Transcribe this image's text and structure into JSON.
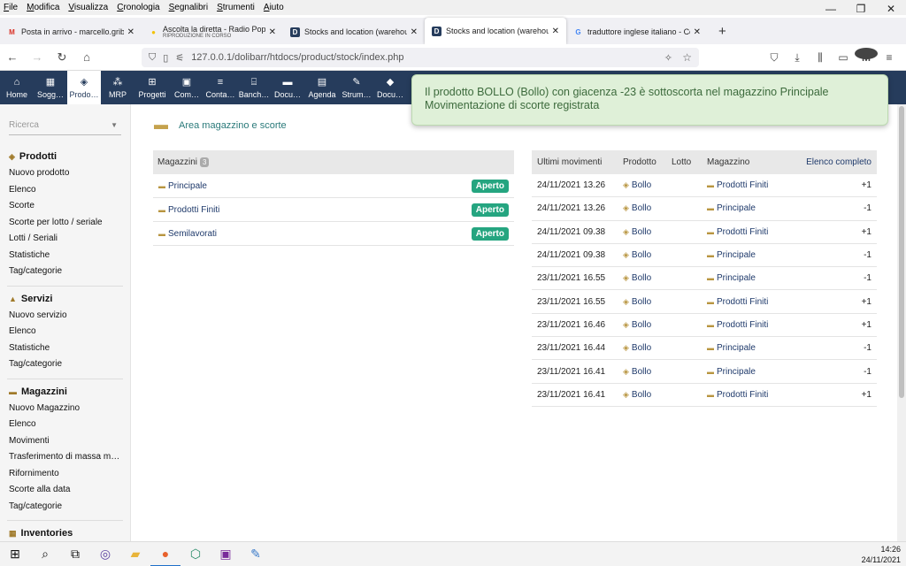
{
  "menubar": {
    "items": [
      {
        "u": "F",
        "rest": "ile"
      },
      {
        "u": "M",
        "rest": "odifica"
      },
      {
        "u": "V",
        "rest": "isualizza"
      },
      {
        "u": "C",
        "rest": "ronologia"
      },
      {
        "u": "S",
        "rest": "egnalibri"
      },
      {
        "u": "S",
        "rest": "trumenti"
      },
      {
        "u": "A",
        "rest": "iuto"
      }
    ]
  },
  "tabs": [
    {
      "title": "Posta in arrivo - marcello.gribau",
      "sub": "",
      "icon": "gmail-icon",
      "color": "#d93025"
    },
    {
      "title": "Ascolta la diretta - Radio Popola",
      "sub": "RIPRODUZIONE IN CORSO",
      "icon": "radio-icon",
      "color": "#f2c200"
    },
    {
      "title": "Stocks and location (warehouse",
      "sub": "",
      "icon": "dolibarr-icon",
      "color": "#263c5c"
    },
    {
      "title": "Stocks and location (warehouse",
      "sub": "",
      "icon": "dolibarr-icon",
      "color": "#263c5c"
    },
    {
      "title": "traduttore inglese italiano - Cerc",
      "sub": "",
      "icon": "google-icon",
      "color": "#4285f4"
    }
  ],
  "url": "127.0.0.1/dolibarr/htdocs/product/stock/index.php",
  "topmenu": [
    {
      "label": "Home",
      "icon": "home-icon",
      "glyph": "⌂"
    },
    {
      "label": "Sogg…",
      "icon": "building-icon",
      "glyph": "▦"
    },
    {
      "label": "Prodo…",
      "icon": "cube-icon",
      "glyph": "◈"
    },
    {
      "label": "MRP",
      "icon": "cubes-icon",
      "glyph": "⁂"
    },
    {
      "label": "Progetti",
      "icon": "sitemap-icon",
      "glyph": "⊞"
    },
    {
      "label": "Com…",
      "icon": "suitcase-icon",
      "glyph": "▣"
    },
    {
      "label": "Conta…",
      "icon": "coins-icon",
      "glyph": "≡"
    },
    {
      "label": "Banch…",
      "icon": "bank-icon",
      "glyph": "⌸"
    },
    {
      "label": "Docu…",
      "icon": "folder-icon",
      "glyph": "▬"
    },
    {
      "label": "Agenda",
      "icon": "calendar-icon",
      "glyph": "▤"
    },
    {
      "label": "Strum…",
      "icon": "wrench-icon",
      "glyph": "✎"
    },
    {
      "label": "Docu…",
      "icon": "book-icon",
      "glyph": "◆"
    }
  ],
  "sidebar": {
    "search_placeholder": "Ricerca",
    "sections": [
      {
        "title": "Prodotti",
        "glyph": "◈",
        "items": [
          "Nuovo prodotto",
          "Elenco",
          "Scorte",
          "Scorte per lotto / seriale",
          "Lotti / Seriali",
          "Statistiche",
          "Tag/categorie"
        ]
      },
      {
        "title": "Servizi",
        "glyph": "▲",
        "items": [
          "Nuovo servizio",
          "Elenco",
          "Statistiche",
          "Tag/categorie"
        ]
      },
      {
        "title": "Magazzini",
        "glyph": "▬",
        "items": [
          "Nuovo Magazzino",
          "Elenco",
          "Movimenti",
          "Trasferimento di massa m…",
          "Rifornimento",
          "Scorte alla data",
          "Tag/categorie"
        ]
      },
      {
        "title": "Inventories",
        "glyph": "▦",
        "items": []
      }
    ]
  },
  "page": {
    "title": "Area magazzino e scorte"
  },
  "warehouses": {
    "header": "Magazzini",
    "count": "3",
    "rows": [
      {
        "name": "Principale",
        "status": "Aperto"
      },
      {
        "name": "Prodotti Finiti",
        "status": "Aperto"
      },
      {
        "name": "Semilavorati",
        "status": "Aperto"
      }
    ]
  },
  "movements": {
    "headers": {
      "date": "Ultimi movimenti",
      "product": "Prodotto",
      "lot": "Lotto",
      "warehouse": "Magazzino",
      "full_list": "Elenco completo"
    },
    "rows": [
      {
        "date": "24/11/2021 13.26",
        "product": "Bollo",
        "lot": "",
        "warehouse": "Prodotti Finiti",
        "qty": "+1"
      },
      {
        "date": "24/11/2021 13.26",
        "product": "Bollo",
        "lot": "",
        "warehouse": "Principale",
        "qty": "-1"
      },
      {
        "date": "24/11/2021 09.38",
        "product": "Bollo",
        "lot": "",
        "warehouse": "Prodotti Finiti",
        "qty": "+1"
      },
      {
        "date": "24/11/2021 09.38",
        "product": "Bollo",
        "lot": "",
        "warehouse": "Principale",
        "qty": "-1"
      },
      {
        "date": "23/11/2021 16.55",
        "product": "Bollo",
        "lot": "",
        "warehouse": "Principale",
        "qty": "-1"
      },
      {
        "date": "23/11/2021 16.55",
        "product": "Bollo",
        "lot": "",
        "warehouse": "Prodotti Finiti",
        "qty": "+1"
      },
      {
        "date": "23/11/2021 16.46",
        "product": "Bollo",
        "lot": "",
        "warehouse": "Prodotti Finiti",
        "qty": "+1"
      },
      {
        "date": "23/11/2021 16.44",
        "product": "Bollo",
        "lot": "",
        "warehouse": "Principale",
        "qty": "-1"
      },
      {
        "date": "23/11/2021 16.41",
        "product": "Bollo",
        "lot": "",
        "warehouse": "Principale",
        "qty": "-1"
      },
      {
        "date": "23/11/2021 16.41",
        "product": "Bollo",
        "lot": "",
        "warehouse": "Prodotti Finiti",
        "qty": "+1"
      }
    ]
  },
  "notification": {
    "line1": "Il prodotto BOLLO (Bollo) con giacenza -23 è sottoscorta nel magazzino Principale",
    "line2": "Movimentazione di scorte registrata"
  },
  "taskbar": {
    "items": [
      "windows-start-icon",
      "search-icon",
      "task-view-icon",
      "app-icon",
      "file-explorer-icon",
      "firefox-icon",
      "app-cube-icon",
      "save-app-icon",
      "paint-icon"
    ],
    "time": "14:26",
    "date": "24/11/2021"
  },
  "colors": {
    "topbar": "#263c5c",
    "status_open": "#25a580",
    "link": "#1f3a6b",
    "toast_bg": "#dff0d8"
  }
}
